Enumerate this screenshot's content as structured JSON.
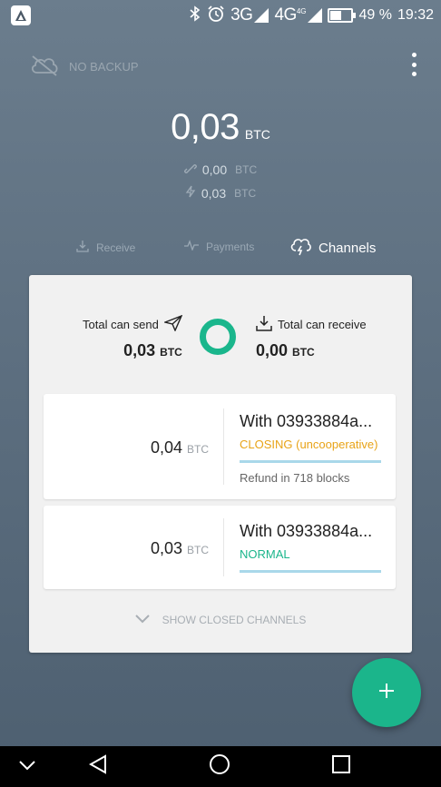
{
  "status_bar": {
    "network_1": "3G",
    "network_2": "4G",
    "network_2_badge": "4G",
    "battery": "49 %",
    "battery_level": 0.49,
    "time": "19:32"
  },
  "header": {
    "backup_label": "NO BACKUP"
  },
  "balance": {
    "total": "0,03",
    "total_unit": "BTC",
    "onchain": "0,00",
    "onchain_unit": "BTC",
    "lightning": "0,03",
    "lightning_unit": "BTC"
  },
  "tabs": [
    {
      "label": "Receive"
    },
    {
      "label": "Payments"
    },
    {
      "label": "Channels"
    }
  ],
  "summary": {
    "send_label": "Total can send",
    "send_value": "0,03",
    "send_unit": "BTC",
    "receive_label": "Total can receive",
    "receive_value": "0,00",
    "receive_unit": "BTC"
  },
  "channels": [
    {
      "amount": "0,04",
      "unit": "BTC",
      "peer": "With 03933884a...",
      "state": "CLOSING (uncooperative)",
      "note": "Refund in 718 blocks"
    },
    {
      "amount": "0,03",
      "unit": "BTC",
      "peer": "With 03933884a...",
      "state": "NORMAL"
    }
  ],
  "show_closed_label": "SHOW CLOSED CHANNELS",
  "colors": {
    "accent": "#1bb58b",
    "closing": "#e8a317",
    "normal": "#1bb58b",
    "bar": "#a9d8ea"
  }
}
